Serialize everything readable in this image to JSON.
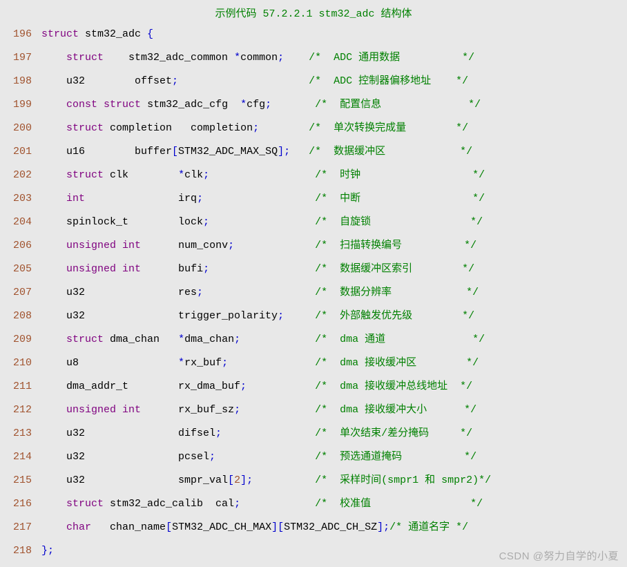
{
  "title": "示例代码 57.2.2.1 stm32_adc 结构体",
  "watermark": "CSDN @努力自学的小夏",
  "lines": [
    {
      "n": "196",
      "seg": [
        {
          "c": "kw",
          "t": "struct"
        },
        {
          "c": "txt",
          "t": " stm32_adc "
        },
        {
          "c": "kw2",
          "t": "{"
        }
      ]
    },
    {
      "n": "197",
      "seg": [
        {
          "c": "txt",
          "t": "    "
        },
        {
          "c": "kw",
          "t": "struct"
        },
        {
          "c": "txt",
          "t": "    stm32_adc_common "
        },
        {
          "c": "kw2",
          "t": "*"
        },
        {
          "c": "txt",
          "t": "common"
        },
        {
          "c": "kw2",
          "t": ";"
        },
        {
          "c": "txt",
          "t": "    "
        },
        {
          "c": "cm",
          "t": "/*  ADC 通用数据          */"
        }
      ]
    },
    {
      "n": "198",
      "seg": [
        {
          "c": "txt",
          "t": "    u32        offset"
        },
        {
          "c": "kw2",
          "t": ";"
        },
        {
          "c": "txt",
          "t": "                     "
        },
        {
          "c": "cm",
          "t": "/*  ADC 控制器偏移地址    */"
        }
      ]
    },
    {
      "n": "199",
      "seg": [
        {
          "c": "txt",
          "t": "    "
        },
        {
          "c": "kw",
          "t": "const"
        },
        {
          "c": "txt",
          "t": " "
        },
        {
          "c": "kw",
          "t": "struct"
        },
        {
          "c": "txt",
          "t": " stm32_adc_cfg  "
        },
        {
          "c": "kw2",
          "t": "*"
        },
        {
          "c": "txt",
          "t": "cfg"
        },
        {
          "c": "kw2",
          "t": ";"
        },
        {
          "c": "txt",
          "t": "       "
        },
        {
          "c": "cm",
          "t": "/*  配置信息              */"
        }
      ]
    },
    {
      "n": "200",
      "seg": [
        {
          "c": "txt",
          "t": "    "
        },
        {
          "c": "kw",
          "t": "struct"
        },
        {
          "c": "txt",
          "t": " completion   completion"
        },
        {
          "c": "kw2",
          "t": ";"
        },
        {
          "c": "txt",
          "t": "        "
        },
        {
          "c": "cm",
          "t": "/*  单次转换完成量        */"
        }
      ]
    },
    {
      "n": "201",
      "seg": [
        {
          "c": "txt",
          "t": "    u16        buffer"
        },
        {
          "c": "kw2",
          "t": "["
        },
        {
          "c": "txt",
          "t": "STM32_ADC_MAX_SQ"
        },
        {
          "c": "kw2",
          "t": "];"
        },
        {
          "c": "txt",
          "t": "   "
        },
        {
          "c": "cm",
          "t": "/*  数据缓冲区            */"
        }
      ]
    },
    {
      "n": "202",
      "seg": [
        {
          "c": "txt",
          "t": "    "
        },
        {
          "c": "kw",
          "t": "struct"
        },
        {
          "c": "txt",
          "t": " clk        "
        },
        {
          "c": "kw2",
          "t": "*"
        },
        {
          "c": "txt",
          "t": "clk"
        },
        {
          "c": "kw2",
          "t": ";"
        },
        {
          "c": "txt",
          "t": "                 "
        },
        {
          "c": "cm",
          "t": "/*  时钟                  */"
        }
      ]
    },
    {
      "n": "203",
      "seg": [
        {
          "c": "txt",
          "t": "    "
        },
        {
          "c": "kw",
          "t": "int"
        },
        {
          "c": "txt",
          "t": "               irq"
        },
        {
          "c": "kw2",
          "t": ";"
        },
        {
          "c": "txt",
          "t": "                  "
        },
        {
          "c": "cm",
          "t": "/*  中断                  */"
        }
      ]
    },
    {
      "n": "204",
      "seg": [
        {
          "c": "txt",
          "t": "    spinlock_t        lock"
        },
        {
          "c": "kw2",
          "t": ";"
        },
        {
          "c": "txt",
          "t": "                 "
        },
        {
          "c": "cm",
          "t": "/*  自旋锁                */"
        }
      ]
    },
    {
      "n": "206",
      "seg": [
        {
          "c": "txt",
          "t": "    "
        },
        {
          "c": "kw",
          "t": "unsigned"
        },
        {
          "c": "txt",
          "t": " "
        },
        {
          "c": "kw",
          "t": "int"
        },
        {
          "c": "txt",
          "t": "      num_conv"
        },
        {
          "c": "kw2",
          "t": ";"
        },
        {
          "c": "txt",
          "t": "             "
        },
        {
          "c": "cm",
          "t": "/*  扫描转换编号          */"
        }
      ]
    },
    {
      "n": "205",
      "seg": [
        {
          "c": "txt",
          "t": "    "
        },
        {
          "c": "kw",
          "t": "unsigned"
        },
        {
          "c": "txt",
          "t": " "
        },
        {
          "c": "kw",
          "t": "int"
        },
        {
          "c": "txt",
          "t": "      bufi"
        },
        {
          "c": "kw2",
          "t": ";"
        },
        {
          "c": "txt",
          "t": "                 "
        },
        {
          "c": "cm",
          "t": "/*  数据缓冲区索引        */"
        }
      ]
    },
    {
      "n": "207",
      "seg": [
        {
          "c": "txt",
          "t": "    u32               res"
        },
        {
          "c": "kw2",
          "t": ";"
        },
        {
          "c": "txt",
          "t": "                  "
        },
        {
          "c": "cm",
          "t": "/*  数据分辨率            */"
        }
      ]
    },
    {
      "n": "208",
      "seg": [
        {
          "c": "txt",
          "t": "    u32               trigger_polarity"
        },
        {
          "c": "kw2",
          "t": ";"
        },
        {
          "c": "txt",
          "t": "     "
        },
        {
          "c": "cm",
          "t": "/*  外部触发优先级        */"
        }
      ]
    },
    {
      "n": "209",
      "seg": [
        {
          "c": "txt",
          "t": "    "
        },
        {
          "c": "kw",
          "t": "struct"
        },
        {
          "c": "txt",
          "t": " dma_chan   "
        },
        {
          "c": "kw2",
          "t": "*"
        },
        {
          "c": "txt",
          "t": "dma_chan"
        },
        {
          "c": "kw2",
          "t": ";"
        },
        {
          "c": "txt",
          "t": "            "
        },
        {
          "c": "cm",
          "t": "/*  dma 通道              */"
        }
      ]
    },
    {
      "n": "210",
      "seg": [
        {
          "c": "txt",
          "t": "    u8                "
        },
        {
          "c": "kw2",
          "t": "*"
        },
        {
          "c": "txt",
          "t": "rx_buf"
        },
        {
          "c": "kw2",
          "t": ";"
        },
        {
          "c": "txt",
          "t": "              "
        },
        {
          "c": "cm",
          "t": "/*  dma 接收缓冲区        */"
        }
      ]
    },
    {
      "n": "211",
      "seg": [
        {
          "c": "txt",
          "t": "    dma_addr_t        rx_dma_buf"
        },
        {
          "c": "kw2",
          "t": ";"
        },
        {
          "c": "txt",
          "t": "           "
        },
        {
          "c": "cm",
          "t": "/*  dma 接收缓冲总线地址  */"
        }
      ]
    },
    {
      "n": "212",
      "seg": [
        {
          "c": "txt",
          "t": "    "
        },
        {
          "c": "kw",
          "t": "unsigned"
        },
        {
          "c": "txt",
          "t": " "
        },
        {
          "c": "kw",
          "t": "int"
        },
        {
          "c": "txt",
          "t": "      rx_buf_sz"
        },
        {
          "c": "kw2",
          "t": ";"
        },
        {
          "c": "txt",
          "t": "            "
        },
        {
          "c": "cm",
          "t": "/*  dma 接收缓冲大小      */"
        }
      ]
    },
    {
      "n": "213",
      "seg": [
        {
          "c": "txt",
          "t": "    u32               difsel"
        },
        {
          "c": "kw2",
          "t": ";"
        },
        {
          "c": "txt",
          "t": "               "
        },
        {
          "c": "cm",
          "t": "/*  单次结束/差分掩码     */"
        }
      ]
    },
    {
      "n": "214",
      "seg": [
        {
          "c": "txt",
          "t": "    u32               pcsel"
        },
        {
          "c": "kw2",
          "t": ";"
        },
        {
          "c": "txt",
          "t": "                "
        },
        {
          "c": "cm",
          "t": "/*  预选通道掩码          */"
        }
      ]
    },
    {
      "n": "215",
      "seg": [
        {
          "c": "txt",
          "t": "    u32               smpr_val"
        },
        {
          "c": "kw2",
          "t": "["
        },
        {
          "c": "num",
          "t": "2"
        },
        {
          "c": "kw2",
          "t": "];"
        },
        {
          "c": "txt",
          "t": "          "
        },
        {
          "c": "cm",
          "t": "/*  采样时间(smpr1 和 smpr2)*/"
        }
      ]
    },
    {
      "n": "216",
      "seg": [
        {
          "c": "txt",
          "t": "    "
        },
        {
          "c": "kw",
          "t": "struct"
        },
        {
          "c": "txt",
          "t": " stm32_adc_calib  cal"
        },
        {
          "c": "kw2",
          "t": ";"
        },
        {
          "c": "txt",
          "t": "            "
        },
        {
          "c": "cm",
          "t": "/*  校准值                */"
        }
      ]
    },
    {
      "n": "217",
      "seg": [
        {
          "c": "txt",
          "t": "    "
        },
        {
          "c": "kw",
          "t": "char"
        },
        {
          "c": "txt",
          "t": "   chan_name"
        },
        {
          "c": "kw2",
          "t": "["
        },
        {
          "c": "txt",
          "t": "STM32_ADC_CH_MAX"
        },
        {
          "c": "kw2",
          "t": "]["
        },
        {
          "c": "txt",
          "t": "STM32_ADC_CH_SZ"
        },
        {
          "c": "kw2",
          "t": "];"
        },
        {
          "c": "cm",
          "t": "/* 通道名字 */"
        }
      ]
    },
    {
      "n": "218",
      "seg": [
        {
          "c": "kw2",
          "t": "};"
        }
      ]
    }
  ]
}
